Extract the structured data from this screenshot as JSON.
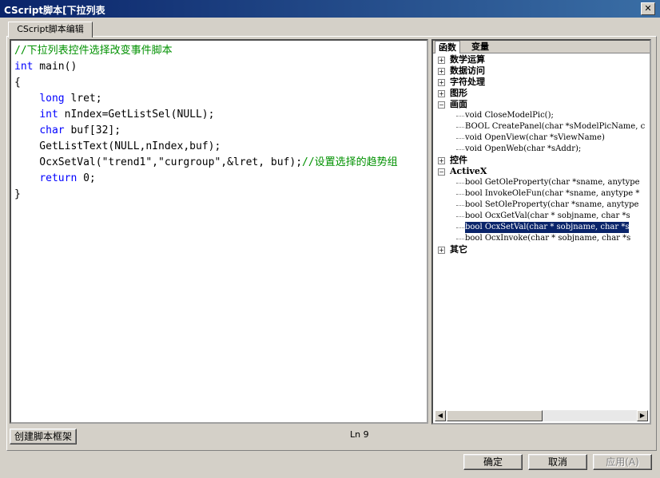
{
  "window": {
    "title": "CScript脚本[下拉列表"
  },
  "tabs": {
    "main": "CScript脚本编辑"
  },
  "editor": {
    "lines": [
      [
        {
          "t": "//下拉列表控件选择改变事件脚本",
          "c": "comment"
        }
      ],
      [
        {
          "t": "int",
          "c": "kw"
        },
        {
          "t": " main()",
          "c": "plain"
        }
      ],
      [
        {
          "t": "{",
          "c": "plain"
        }
      ],
      [
        {
          "t": "    ",
          "c": "plain"
        },
        {
          "t": "long",
          "c": "kw"
        },
        {
          "t": " lret;",
          "c": "plain"
        }
      ],
      [
        {
          "t": "    ",
          "c": "plain"
        },
        {
          "t": "int",
          "c": "kw"
        },
        {
          "t": " nIndex=GetListSel(NULL);",
          "c": "plain"
        }
      ],
      [
        {
          "t": "    ",
          "c": "plain"
        },
        {
          "t": "char",
          "c": "kw"
        },
        {
          "t": " buf[32];",
          "c": "plain"
        }
      ],
      [
        {
          "t": "    GetListText(NULL,nIndex,buf);",
          "c": "plain"
        }
      ],
      [
        {
          "t": "    OcxSetVal(\"trend1\",\"curgroup\",&lret, buf);",
          "c": "plain"
        },
        {
          "t": "//设置选择的趋势组",
          "c": "comment"
        }
      ],
      [
        {
          "t": "    ",
          "c": "plain"
        },
        {
          "t": "return",
          "c": "kw"
        },
        {
          "t": " 0;",
          "c": "plain"
        }
      ],
      [
        {
          "t": "}",
          "c": "plain"
        }
      ]
    ]
  },
  "right_tabs": {
    "functions": "函数",
    "variables": "变量"
  },
  "tree": [
    {
      "label": "数学运算",
      "expanded": false,
      "children": []
    },
    {
      "label": "数据访问",
      "expanded": false,
      "children": []
    },
    {
      "label": "字符处理",
      "expanded": false,
      "children": []
    },
    {
      "label": "图形",
      "expanded": false,
      "children": []
    },
    {
      "label": "画面",
      "expanded": true,
      "children": [
        "void CloseModelPic();",
        "BOOL CreatePanel(char *sModelPicName, c",
        "void OpenView(char *sViewName)",
        "void OpenWeb(char *sAddr);"
      ]
    },
    {
      "label": "控件",
      "expanded": false,
      "children": []
    },
    {
      "label": "ActiveX",
      "expanded": true,
      "children": [
        "bool GetOleProperty(char *sname, anytype",
        "bool InvokeOleFun(char *sname, anytype *",
        "bool SetOleProperty(char *sname, anytype",
        "bool OcxGetVal(char * sobjname, char *s",
        "bool OcxSetVal(char * sobjname, char *s",
        "bool OcxInvoke(char * sobjname, char *s"
      ]
    },
    {
      "label": "其它",
      "expanded": false,
      "children": []
    }
  ],
  "selected_item": "bool OcxSetVal(char * sobjname, char *s",
  "buttons": {
    "create_frame": "创建脚本框架",
    "ok": "确定",
    "cancel": "取消",
    "apply": "应用(A)"
  },
  "status": {
    "line": "Ln 9"
  },
  "icons": {
    "close": "close-icon",
    "expand": "plus-icon",
    "collapse": "minus-icon",
    "scroll_left": "arrow-left-icon",
    "scroll_right": "arrow-right-icon"
  }
}
